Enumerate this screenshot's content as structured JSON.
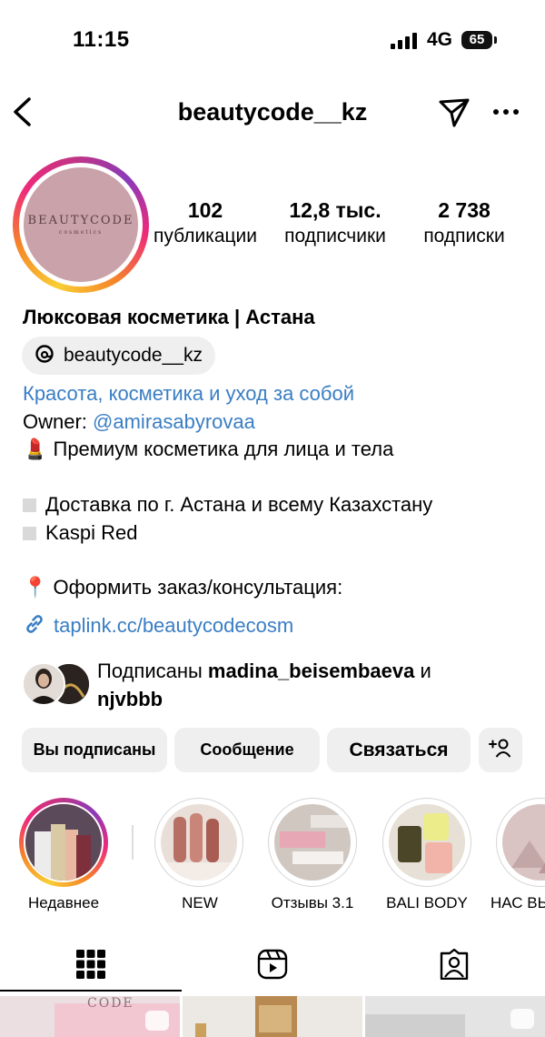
{
  "status_bar": {
    "time": "11:15",
    "network": "4G",
    "battery": "65"
  },
  "header": {
    "username": "beautycode__kz"
  },
  "avatar": {
    "logo_text": "BEAUTYCODE",
    "logo_subtext": "cosmetics"
  },
  "stats": [
    {
      "value": "102",
      "label": "публикации"
    },
    {
      "value": "12,8 тыс.",
      "label": "подписчики"
    },
    {
      "value": "2 738",
      "label": "подписки"
    }
  ],
  "bio": {
    "name": "Люксовая косметика | Астана",
    "threads_handle": "beautycode__kz",
    "category": "Красота, косметика и уход за собой",
    "owner_label": "Owner: ",
    "owner_handle": "@amirasabyrovaa",
    "line_premium": "💄 Премиум косметика для лица и тела",
    "line_delivery": "Доставка по г. Астана и всему Казахстану",
    "line_kaspi": "Kaspi Red",
    "line_order": "📍 Оформить заказ/консультация:",
    "link": "taplink.cc/beautycodecosm"
  },
  "followed_by": {
    "prefix": "Подписаны ",
    "user1": "madina_beisembaeva",
    "conj": " и",
    "user2": "njvbbb"
  },
  "buttons": {
    "following": "Вы подписаны",
    "message": "Сообщение",
    "contact": "Связаться"
  },
  "highlights": [
    {
      "label": "Недавнее"
    },
    {
      "label": "NEW"
    },
    {
      "label": "Отзывы 3.1"
    },
    {
      "label": "BALI BODY"
    },
    {
      "label": "НАС ВЫ"
    }
  ],
  "colors": {
    "link_blue": "#3a7ec4",
    "button_bg": "#efefef"
  }
}
